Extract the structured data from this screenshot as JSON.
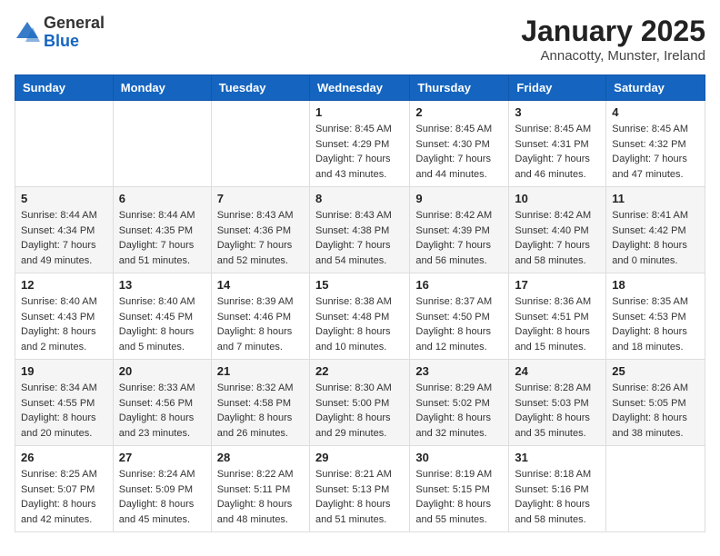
{
  "header": {
    "logo_general": "General",
    "logo_blue": "Blue",
    "month_year": "January 2025",
    "location": "Annacotty, Munster, Ireland"
  },
  "weekdays": [
    "Sunday",
    "Monday",
    "Tuesday",
    "Wednesday",
    "Thursday",
    "Friday",
    "Saturday"
  ],
  "weeks": [
    [
      {
        "day": "",
        "content": ""
      },
      {
        "day": "",
        "content": ""
      },
      {
        "day": "",
        "content": ""
      },
      {
        "day": "1",
        "content": "Sunrise: 8:45 AM\nSunset: 4:29 PM\nDaylight: 7 hours\nand 43 minutes."
      },
      {
        "day": "2",
        "content": "Sunrise: 8:45 AM\nSunset: 4:30 PM\nDaylight: 7 hours\nand 44 minutes."
      },
      {
        "day": "3",
        "content": "Sunrise: 8:45 AM\nSunset: 4:31 PM\nDaylight: 7 hours\nand 46 minutes."
      },
      {
        "day": "4",
        "content": "Sunrise: 8:45 AM\nSunset: 4:32 PM\nDaylight: 7 hours\nand 47 minutes."
      }
    ],
    [
      {
        "day": "5",
        "content": "Sunrise: 8:44 AM\nSunset: 4:34 PM\nDaylight: 7 hours\nand 49 minutes."
      },
      {
        "day": "6",
        "content": "Sunrise: 8:44 AM\nSunset: 4:35 PM\nDaylight: 7 hours\nand 51 minutes."
      },
      {
        "day": "7",
        "content": "Sunrise: 8:43 AM\nSunset: 4:36 PM\nDaylight: 7 hours\nand 52 minutes."
      },
      {
        "day": "8",
        "content": "Sunrise: 8:43 AM\nSunset: 4:38 PM\nDaylight: 7 hours\nand 54 minutes."
      },
      {
        "day": "9",
        "content": "Sunrise: 8:42 AM\nSunset: 4:39 PM\nDaylight: 7 hours\nand 56 minutes."
      },
      {
        "day": "10",
        "content": "Sunrise: 8:42 AM\nSunset: 4:40 PM\nDaylight: 7 hours\nand 58 minutes."
      },
      {
        "day": "11",
        "content": "Sunrise: 8:41 AM\nSunset: 4:42 PM\nDaylight: 8 hours\nand 0 minutes."
      }
    ],
    [
      {
        "day": "12",
        "content": "Sunrise: 8:40 AM\nSunset: 4:43 PM\nDaylight: 8 hours\nand 2 minutes."
      },
      {
        "day": "13",
        "content": "Sunrise: 8:40 AM\nSunset: 4:45 PM\nDaylight: 8 hours\nand 5 minutes."
      },
      {
        "day": "14",
        "content": "Sunrise: 8:39 AM\nSunset: 4:46 PM\nDaylight: 8 hours\nand 7 minutes."
      },
      {
        "day": "15",
        "content": "Sunrise: 8:38 AM\nSunset: 4:48 PM\nDaylight: 8 hours\nand 10 minutes."
      },
      {
        "day": "16",
        "content": "Sunrise: 8:37 AM\nSunset: 4:50 PM\nDaylight: 8 hours\nand 12 minutes."
      },
      {
        "day": "17",
        "content": "Sunrise: 8:36 AM\nSunset: 4:51 PM\nDaylight: 8 hours\nand 15 minutes."
      },
      {
        "day": "18",
        "content": "Sunrise: 8:35 AM\nSunset: 4:53 PM\nDaylight: 8 hours\nand 18 minutes."
      }
    ],
    [
      {
        "day": "19",
        "content": "Sunrise: 8:34 AM\nSunset: 4:55 PM\nDaylight: 8 hours\nand 20 minutes."
      },
      {
        "day": "20",
        "content": "Sunrise: 8:33 AM\nSunset: 4:56 PM\nDaylight: 8 hours\nand 23 minutes."
      },
      {
        "day": "21",
        "content": "Sunrise: 8:32 AM\nSunset: 4:58 PM\nDaylight: 8 hours\nand 26 minutes."
      },
      {
        "day": "22",
        "content": "Sunrise: 8:30 AM\nSunset: 5:00 PM\nDaylight: 8 hours\nand 29 minutes."
      },
      {
        "day": "23",
        "content": "Sunrise: 8:29 AM\nSunset: 5:02 PM\nDaylight: 8 hours\nand 32 minutes."
      },
      {
        "day": "24",
        "content": "Sunrise: 8:28 AM\nSunset: 5:03 PM\nDaylight: 8 hours\nand 35 minutes."
      },
      {
        "day": "25",
        "content": "Sunrise: 8:26 AM\nSunset: 5:05 PM\nDaylight: 8 hours\nand 38 minutes."
      }
    ],
    [
      {
        "day": "26",
        "content": "Sunrise: 8:25 AM\nSunset: 5:07 PM\nDaylight: 8 hours\nand 42 minutes."
      },
      {
        "day": "27",
        "content": "Sunrise: 8:24 AM\nSunset: 5:09 PM\nDaylight: 8 hours\nand 45 minutes."
      },
      {
        "day": "28",
        "content": "Sunrise: 8:22 AM\nSunset: 5:11 PM\nDaylight: 8 hours\nand 48 minutes."
      },
      {
        "day": "29",
        "content": "Sunrise: 8:21 AM\nSunset: 5:13 PM\nDaylight: 8 hours\nand 51 minutes."
      },
      {
        "day": "30",
        "content": "Sunrise: 8:19 AM\nSunset: 5:15 PM\nDaylight: 8 hours\nand 55 minutes."
      },
      {
        "day": "31",
        "content": "Sunrise: 8:18 AM\nSunset: 5:16 PM\nDaylight: 8 hours\nand 58 minutes."
      },
      {
        "day": "",
        "content": ""
      }
    ]
  ]
}
